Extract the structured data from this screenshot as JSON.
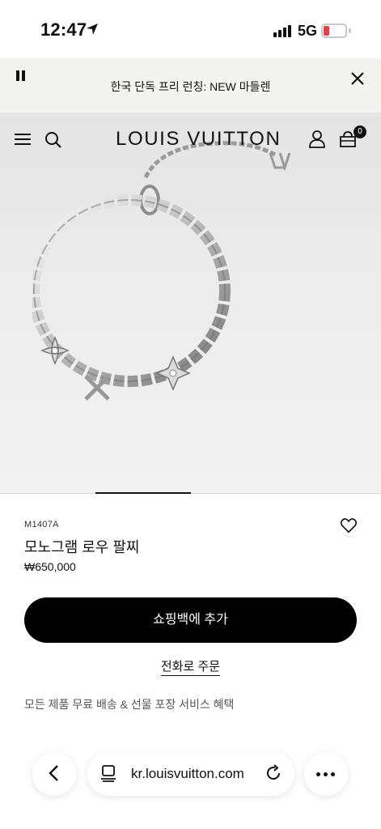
{
  "status_bar": {
    "time": "12:47",
    "network": "5G",
    "battery": "7"
  },
  "promo": {
    "text": "한국 단독 프리 런칭: NEW 마들렌"
  },
  "header": {
    "logo": "LOUIS VUITTON",
    "bag_count": "0"
  },
  "hero": {
    "slide_index": 1
  },
  "product": {
    "sku": "M1407A",
    "name": "모노그램 로우 팔찌",
    "price": "₩650,000",
    "add_to_bag": "쇼핑백에 추가",
    "phone_order": "전화로 주문",
    "benefit": "모든 제품 무료 배송 & 선물 포장 서비스 혜택"
  },
  "browser": {
    "url": "kr.louisvuitton.com"
  },
  "colors": {
    "accent": "#000000",
    "battery_low": "#e0414a"
  }
}
